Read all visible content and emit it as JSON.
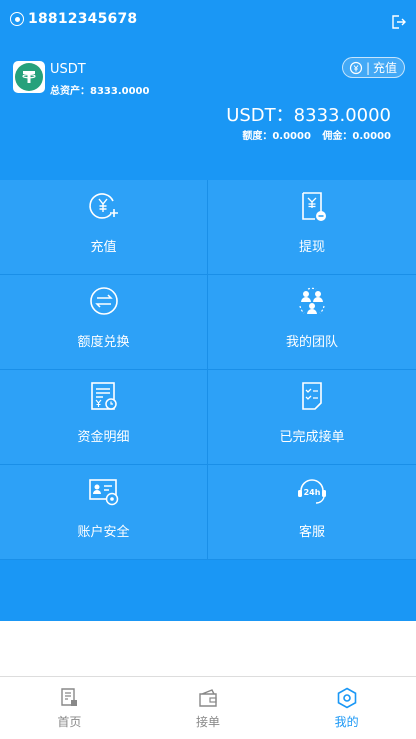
{
  "header": {
    "phone": "18812345678",
    "coin_name": "USDT",
    "total_assets": "总资产：8333.0000",
    "recharge_label": "充值",
    "balance_line": "USDT：8333.0000",
    "quota": "额度：0.0000",
    "commission": "佣金：0.0000"
  },
  "grid": [
    {
      "label": "充值",
      "icon": "yen-plus-icon"
    },
    {
      "label": "提现",
      "icon": "withdraw-icon"
    },
    {
      "label": "额度兑换",
      "icon": "exchange-icon"
    },
    {
      "label": "我的团队",
      "icon": "team-icon"
    },
    {
      "label": "资金明细",
      "icon": "ledger-icon"
    },
    {
      "label": "已完成接单",
      "icon": "checklist-icon"
    },
    {
      "label": "账户安全",
      "icon": "security-icon"
    },
    {
      "label": "客服",
      "icon": "support-24h-icon"
    }
  ],
  "tabs": [
    {
      "label": "首页",
      "icon": "home-receipt-icon"
    },
    {
      "label": "接单",
      "icon": "wallet-icon"
    },
    {
      "label": "我的",
      "icon": "hexagon-icon"
    }
  ],
  "colors": {
    "primary": "#1a97f5",
    "tile": "#2da1f7",
    "tether": "#26a17b"
  }
}
